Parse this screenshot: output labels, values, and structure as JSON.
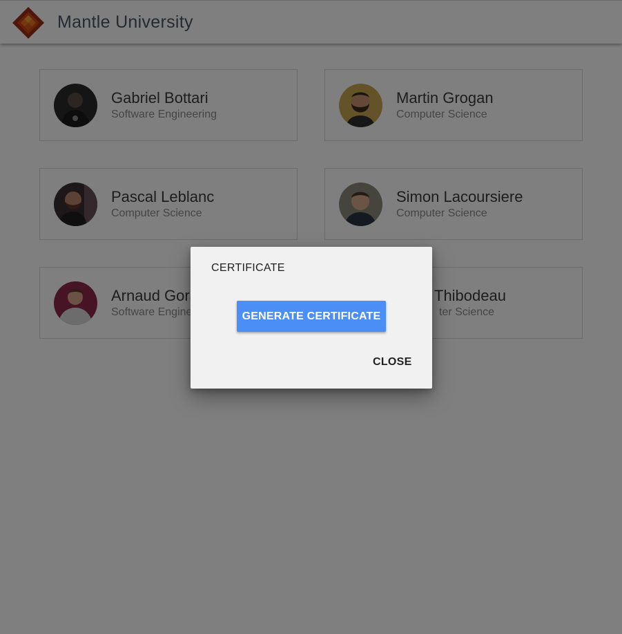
{
  "app": {
    "title": "Mantle University"
  },
  "students": [
    {
      "name": "Gabriel Bottari",
      "program": "Software Engineering",
      "avatar": "person-avatar"
    },
    {
      "name": "Martin Grogan",
      "program": "Computer Science",
      "avatar": "person-avatar"
    },
    {
      "name": "Pascal Leblanc",
      "program": "Computer Science",
      "avatar": "person-avatar"
    },
    {
      "name": "Simon Lacoursiere",
      "program": "Computer Science",
      "avatar": "person-avatar"
    },
    {
      "name": "Arnaud Gora",
      "program": "Software Engine",
      "avatar": "person-avatar"
    },
    {
      "name": "Thibodeau",
      "program": "ter Science",
      "avatar": "person-avatar"
    }
  ],
  "dialog": {
    "title": "CERTIFICATE",
    "generate_label": "GENERATE CERTIFICATE",
    "close_label": "CLOSE"
  },
  "colors": {
    "primary": "#4a8ef6",
    "logo_outer": "#b5301a",
    "logo_inner": "#f0801e",
    "overlay": "rgba(0,0,0,0.5)"
  }
}
